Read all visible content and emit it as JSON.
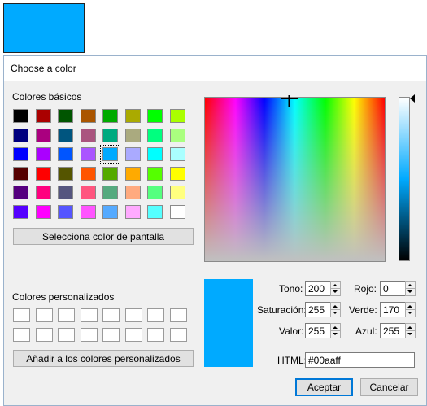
{
  "window": {
    "title": "Choose a color"
  },
  "basic_colors": {
    "label": "Colores básicos",
    "rows": [
      [
        "#000000",
        "#aa0000",
        "#005500",
        "#aa5500",
        "#00aa00",
        "#aaaa00",
        "#00ff00",
        "#aaff00"
      ],
      [
        "#00007f",
        "#aa007f",
        "#00557f",
        "#aa557f",
        "#00aa7f",
        "#aaaa7f",
        "#00ff7f",
        "#aaff7f"
      ],
      [
        "#0000ff",
        "#aa00ff",
        "#0055ff",
        "#aa55ff",
        "#00aaff",
        "#aaaaff",
        "#00ffff",
        "#aaffff"
      ],
      [
        "#550000",
        "#ff0000",
        "#555500",
        "#ff5500",
        "#55aa00",
        "#ffaa00",
        "#55ff00",
        "#ffff00"
      ],
      [
        "#55007f",
        "#ff007f",
        "#55557f",
        "#ff557f",
        "#55aa7f",
        "#ffaa7f",
        "#55ff7f",
        "#ffff7f"
      ],
      [
        "#5500ff",
        "#ff00ff",
        "#5555ff",
        "#ff55ff",
        "#55aaff",
        "#ffaaff",
        "#55ffff",
        "#ffffff"
      ]
    ],
    "selected": "#00aaff"
  },
  "screen_pick_button": {
    "label": "Selecciona color de pantalla"
  },
  "custom_colors": {
    "label": "Colores personalizados"
  },
  "add_custom_button": {
    "label": "Añadir a los colores personalizados"
  },
  "current_color": "#00aaff",
  "fields": {
    "hue": {
      "label": "Tono:",
      "value": "200"
    },
    "saturation": {
      "label": "Saturación:",
      "value": "255"
    },
    "value": {
      "label": "Valor:",
      "value": "255"
    },
    "red": {
      "label": "Rojo:",
      "value": "0"
    },
    "green": {
      "label": "Verde:",
      "value": "170"
    },
    "blue": {
      "label": "Azul:",
      "value": "255"
    },
    "html": {
      "label": "HTML:",
      "value": "#00aaff"
    }
  },
  "buttons": {
    "accept": "Aceptar",
    "cancel": "Cancelar"
  }
}
